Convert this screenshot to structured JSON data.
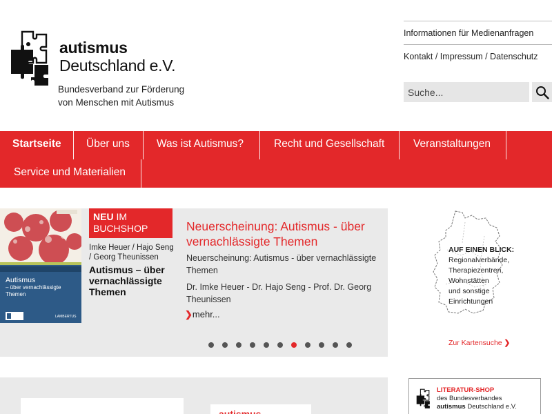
{
  "brand": {
    "name": "autismus",
    "sub": "Deutschland e.V.",
    "tagline_1": "Bundesverband zur Förderung",
    "tagline_2": "von Menschen mit Autismus"
  },
  "toplinks": {
    "media": "Informationen für Medienanfragen",
    "contact": "Kontakt / Impressum / Datenschutz"
  },
  "search": {
    "placeholder": "Suche...",
    "icon": "search-icon"
  },
  "nav": {
    "items": [
      {
        "label": "Startseite",
        "active": true
      },
      {
        "label": "Über uns"
      },
      {
        "label": "Was ist Autismus?"
      },
      {
        "label": "Recht und Gesellschaft"
      },
      {
        "label": "Veranstaltungen"
      },
      {
        "label": "Service und Materialien"
      }
    ]
  },
  "slider": {
    "cover_title_1": "Autismus",
    "cover_title_2": "– über vernachlässigte Themen",
    "cover_publisher": "LAMBERTUS",
    "badge_bold": "NEU",
    "badge_rest": "IM",
    "badge_line2": "BUCHSHOP",
    "book_authors": "Imke Heuer / Hajo Seng / Georg Theunissen",
    "book_heading": "Autismus – über vernachlässigte Themen",
    "title": "Neuerscheinung: Autismus - über vernachlässigte Themen",
    "lead": "Neuerscheinung: Autismus - über vernachlässigte Themen",
    "authors": "Dr. Imke Heuer - Dr. Hajo Seng - Prof. Dr. Georg Theunissen",
    "more": "mehr...",
    "dot_count": 11,
    "active_dot": 6
  },
  "map": {
    "heading": "AUF EINEN BLICK:",
    "line1": "Regionalverbände,",
    "line2": "Therapiezentren,",
    "line3": "Wohnstätten",
    "line4": "und sonstige",
    "line5": "Einrichtungen",
    "link": "Zur Kartensuche"
  },
  "shop": {
    "title": "LITERATUR-SHOP",
    "line1": "des Bundesverbandes",
    "line2_bold": "autismus",
    "line2_rest": "Deutschland e.V."
  },
  "bottom": {
    "fragment": "autismus"
  },
  "colors": {
    "accent": "#e3282a",
    "slider_bg": "#eaeaea",
    "cover_band": "#2d5a87"
  }
}
